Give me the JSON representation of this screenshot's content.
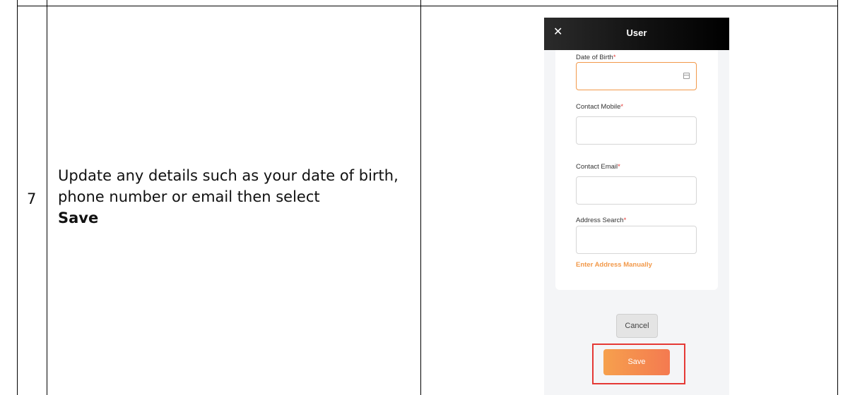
{
  "document": {
    "step_number": "7",
    "instruction_text": "Update any details such as your date of birth, phone number or email then select",
    "instruction_bold": "Save"
  },
  "app": {
    "title": "User",
    "close_icon": "close-icon",
    "fields": {
      "dob_label": "Date of Birth",
      "mobile_label": "Contact Mobile",
      "email_label": "Contact Email",
      "address_label": "Address Search",
      "required_marker": "*"
    },
    "manual_address_link": "Enter Address Manually",
    "cancel_label": "Cancel",
    "save_label": "Save",
    "accent_color": "#f2994a",
    "highlight_color": "#e53935"
  }
}
